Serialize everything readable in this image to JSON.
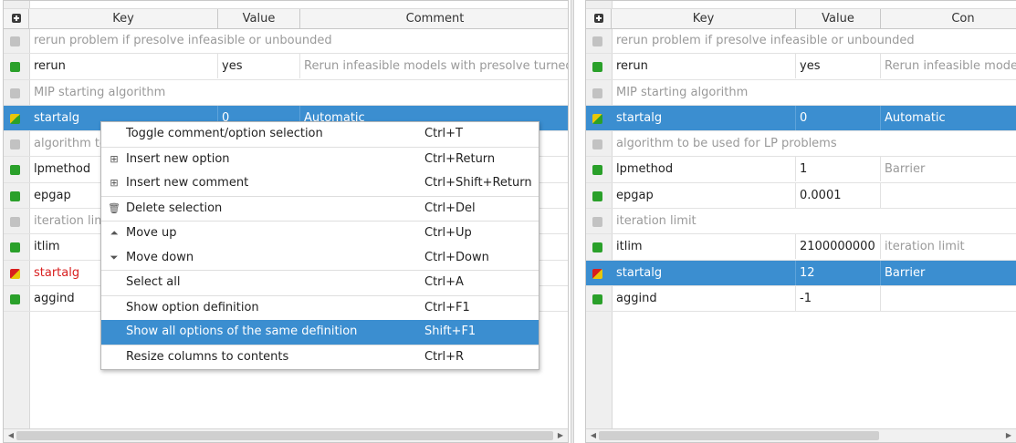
{
  "columns": {
    "key": "Key",
    "value": "Value",
    "comment": "Comment",
    "comment_truncated": "Con"
  },
  "left": {
    "rows": [
      {
        "type": "comment",
        "text": "rerun problem if presolve infeasible or unbounded"
      },
      {
        "type": "option",
        "ind": "green",
        "key": "rerun",
        "value": "yes",
        "comment": "Rerun infeasible models with presolve turned o"
      },
      {
        "type": "comment",
        "text": "MIP starting algorithm"
      },
      {
        "type": "option",
        "ind": "mixg",
        "key": "startalg",
        "value": "0",
        "comment": "Automatic",
        "selected": true
      },
      {
        "type": "comment",
        "text": "algorithm to"
      },
      {
        "type": "option",
        "ind": "green",
        "key": "lpmethod",
        "value": "",
        "comment": ""
      },
      {
        "type": "option",
        "ind": "green",
        "key": "epgap",
        "value": "",
        "comment": ""
      },
      {
        "type": "comment",
        "text": "iteration limi"
      },
      {
        "type": "option",
        "ind": "green",
        "key": "itlim",
        "value": "",
        "comment": ""
      },
      {
        "type": "option",
        "ind": "mixr",
        "key": "startalg",
        "value": "",
        "comment": "",
        "error": true
      },
      {
        "type": "option",
        "ind": "green",
        "key": "aggind",
        "value": "",
        "comment": ""
      }
    ]
  },
  "right": {
    "rows": [
      {
        "type": "comment",
        "text": "rerun problem if presolve infeasible or unbounded"
      },
      {
        "type": "option",
        "ind": "green",
        "key": "rerun",
        "value": "yes",
        "comment": "Rerun infeasible models"
      },
      {
        "type": "comment",
        "text": "MIP starting algorithm"
      },
      {
        "type": "option",
        "ind": "mixg",
        "key": "startalg",
        "value": "0",
        "comment": "Automatic",
        "selected": true
      },
      {
        "type": "comment",
        "text": "algorithm to be used for LP problems"
      },
      {
        "type": "option",
        "ind": "green",
        "key": "lpmethod",
        "value": "1",
        "comment": "Barrier"
      },
      {
        "type": "option",
        "ind": "green",
        "key": "epgap",
        "value": "0.0001",
        "comment": ""
      },
      {
        "type": "comment",
        "text": "iteration limit"
      },
      {
        "type": "option",
        "ind": "green",
        "key": "itlim",
        "value": "2100000000",
        "comment": "iteration limit"
      },
      {
        "type": "option",
        "ind": "mixr",
        "key": "startalg",
        "value": "12",
        "comment": "Barrier",
        "selected": true
      },
      {
        "type": "option",
        "ind": "green",
        "key": "aggind",
        "value": "-1",
        "comment": ""
      }
    ]
  },
  "context_menu": {
    "items": [
      {
        "icon": "",
        "icon_name": "",
        "label": "Toggle comment/option selection",
        "shortcut": "Ctrl+T"
      },
      {
        "sep": true
      },
      {
        "icon": "⊞",
        "icon_name": "insert-option-icon",
        "label": "Insert new option",
        "shortcut": "Ctrl+Return"
      },
      {
        "icon": "⊞",
        "icon_name": "insert-comment-icon",
        "label": "Insert new comment",
        "shortcut": "Ctrl+Shift+Return"
      },
      {
        "sep": true
      },
      {
        "icon": "🗑",
        "icon_name": "trash-icon",
        "label": "Delete selection",
        "shortcut": "Ctrl+Del"
      },
      {
        "sep": true
      },
      {
        "icon": "⏶",
        "icon_name": "move-up-icon",
        "label": "Move up",
        "shortcut": "Ctrl+Up"
      },
      {
        "icon": "⏷",
        "icon_name": "move-down-icon",
        "label": "Move down",
        "shortcut": "Ctrl+Down"
      },
      {
        "sep": true
      },
      {
        "icon": "",
        "icon_name": "",
        "label": "Select all",
        "shortcut": "Ctrl+A"
      },
      {
        "sep": true
      },
      {
        "icon": "",
        "icon_name": "",
        "label": "Show option definition",
        "shortcut": "Ctrl+F1"
      },
      {
        "icon": "",
        "icon_name": "",
        "label": "Show all options of the same definition",
        "shortcut": "Shift+F1",
        "highlighted": true
      },
      {
        "sep": true
      },
      {
        "icon": "",
        "icon_name": "",
        "label": "Resize columns to contents",
        "shortcut": "Ctrl+R"
      }
    ]
  },
  "colors": {
    "selection": "#3b8ed0",
    "option_indicator": "#2aa02a",
    "comment_indicator": "#c2c2c2",
    "error_text": "#d81e1e",
    "comment_text": "#9a9a9a"
  }
}
